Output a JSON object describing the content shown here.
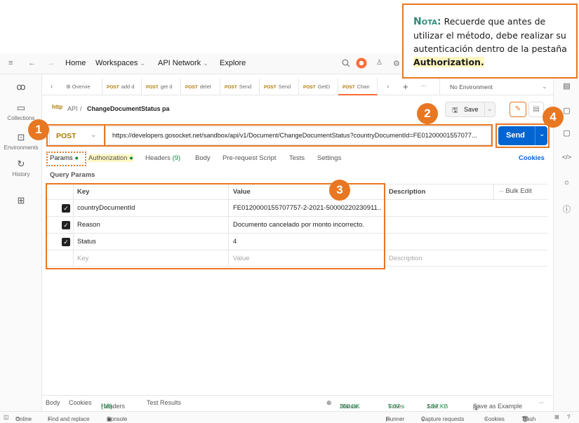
{
  "topbar": {
    "menu_icon": "≡",
    "back_icon": "←",
    "forward_icon": "→",
    "home": "Home",
    "workspaces": "Workspaces",
    "api_network": "API Network",
    "explore": "Explore"
  },
  "sidebar": {
    "items": [
      {
        "label": "",
        "icon": "person-group-icon"
      },
      {
        "label": "Collections",
        "icon": "trash-can-icon"
      },
      {
        "label": "Environments",
        "icon": "environment-icon"
      },
      {
        "label": "History",
        "icon": "history-icon"
      },
      {
        "label": "",
        "icon": "apps-icon"
      }
    ]
  },
  "tabs": [
    {
      "method": "",
      "label": "Overvie"
    },
    {
      "method": "POST",
      "label": "add d"
    },
    {
      "method": "POST",
      "label": "get d"
    },
    {
      "method": "POST",
      "label": "delet"
    },
    {
      "method": "POST",
      "label": "Send"
    },
    {
      "method": "POST",
      "label": "Send"
    },
    {
      "method": "POST",
      "label": "GetD"
    },
    {
      "method": "POST",
      "label": "Chan"
    }
  ],
  "environment": "No Environment",
  "breadcrumb": {
    "parent": "API",
    "separator": "/",
    "current": "ChangeDocumentStatus pa"
  },
  "save_label": "Save",
  "request": {
    "method": "POST",
    "url": "https://developers.gosocket.net/sandbox/api/v1/Document/ChangeDocumentStatus?countryDocumentId=FE01200001557077...",
    "send_label": "Send"
  },
  "subtabs": {
    "params": "Params",
    "authorization": "Authorization",
    "headers": "Headers",
    "headers_count": "(9)",
    "body": "Body",
    "prerequest": "Pre-request Script",
    "tests": "Tests",
    "settings": "Settings",
    "cookies": "Cookies"
  },
  "query_params": {
    "title": "Query Params",
    "col_key": "Key",
    "col_value": "Value",
    "col_description": "Description",
    "bulk_edit": "Bulk Edit",
    "rows": [
      {
        "key": "countryDocumentId",
        "value": "FE0120000155707757-2-2021-50000220230911..."
      },
      {
        "key": "Reason",
        "value": "Documento cancelado por monto incorrecto."
      },
      {
        "key": "Status",
        "value": "4"
      }
    ],
    "placeholder_key": "Key",
    "placeholder_value": "Value",
    "placeholder_description": "Description"
  },
  "badges": [
    "1",
    "2",
    "3",
    "4"
  ],
  "nota": {
    "label": "Nota:",
    "text_1": "Recuerde que antes de utilizar el método, debe realizar su autenticación dentro de la pestaña",
    "highlight": "Authorization."
  },
  "response_tabs": {
    "body": "Body",
    "cookies": "Cookies",
    "headers": "Headers",
    "headers_count": "(18)",
    "test_results": "Test Results"
  },
  "response_meta": {
    "status_label": "Status:",
    "status_value": "200 OK",
    "time_label": "Time:",
    "time_value": "5.07 s",
    "size_label": "Size:",
    "size_value": "1.97 KB",
    "save_example": "Save as Example"
  },
  "statusbar": {
    "online": "Online",
    "find_replace": "Find and replace",
    "console": "Console",
    "runner": "Runner",
    "capture": "Capture requests",
    "cookies": "Cookies",
    "trash": "Trash"
  },
  "colors": {
    "accent_orange": "#e87722",
    "send_blue": "#0265d2",
    "status_green": "#0f8a3c",
    "method_yellow": "#ad7a03",
    "nota_green": "#2b8a7a"
  }
}
